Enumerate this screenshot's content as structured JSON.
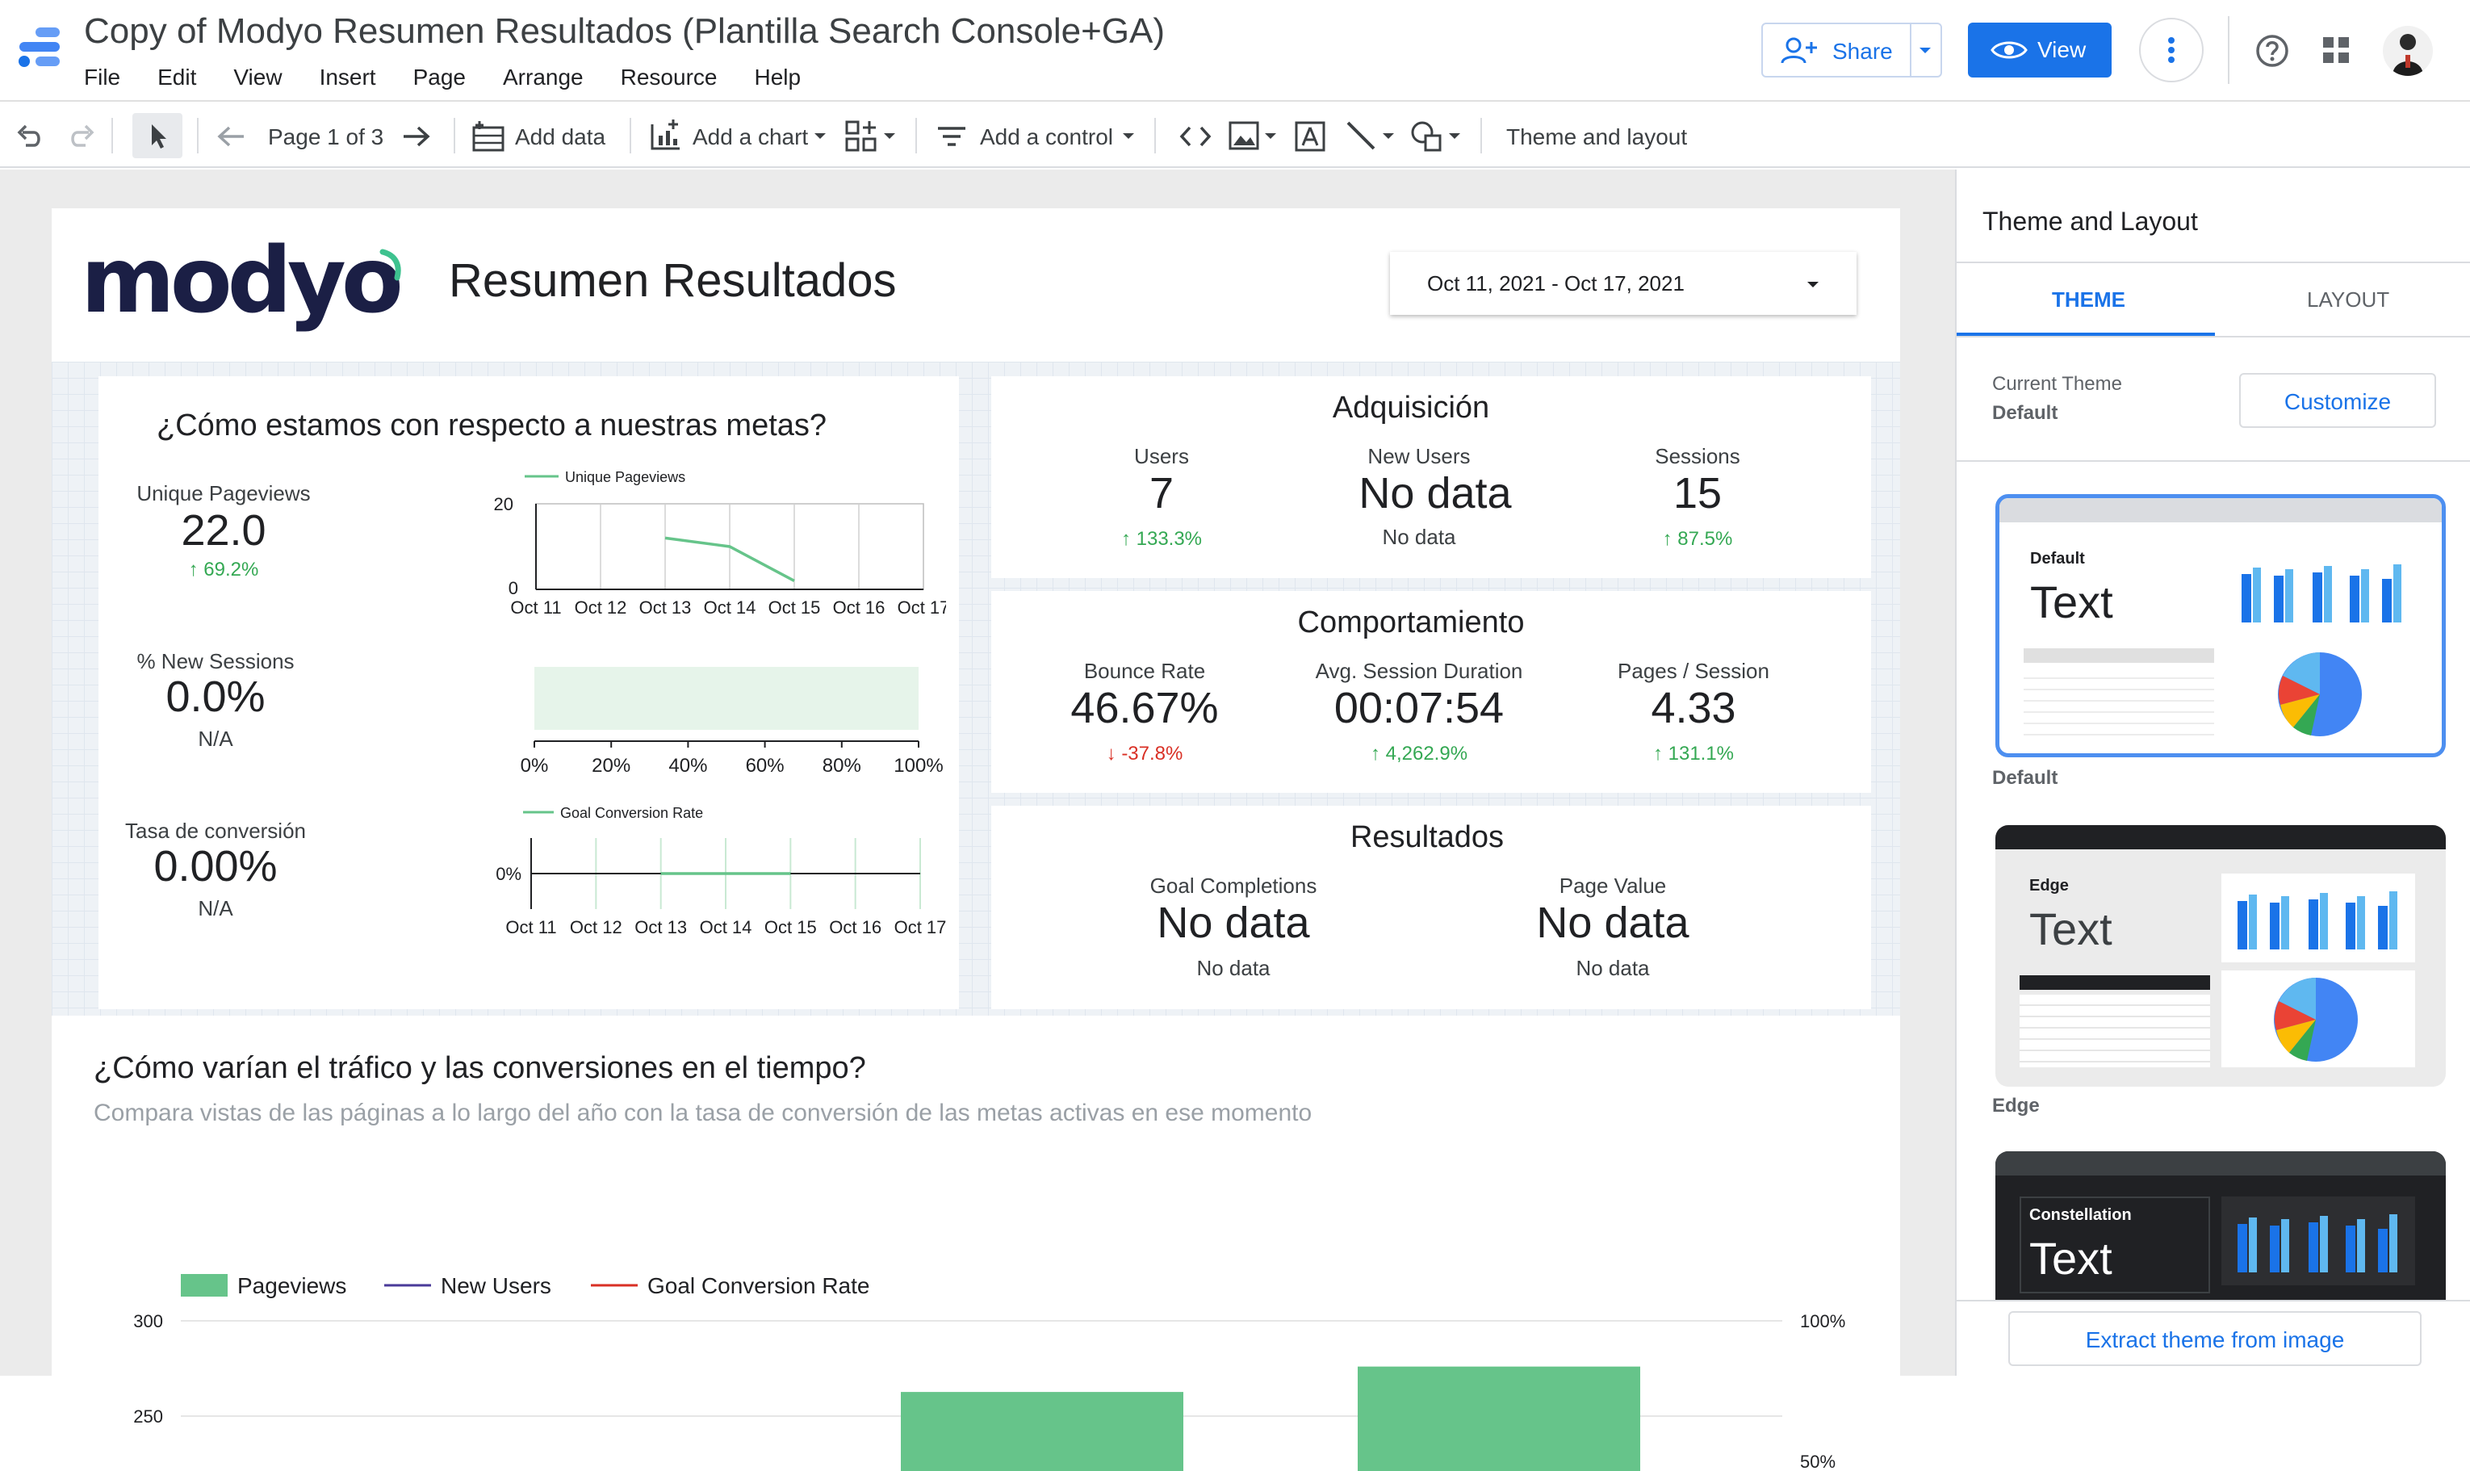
{
  "app": {
    "title": "Copy of Modyo Resumen Resultados (Plantilla Search Console+GA)",
    "menu": [
      "File",
      "Edit",
      "View",
      "Insert",
      "Page",
      "Arrange",
      "Resource",
      "Help"
    ],
    "share_label": "Share",
    "view_label": "View"
  },
  "toolbar": {
    "page_indicator": "Page 1 of 3",
    "add_data": "Add data",
    "add_chart": "Add a chart",
    "add_control": "Add a control",
    "theme_layout": "Theme and layout"
  },
  "report": {
    "logo_text": "modyo",
    "title": "Resumen Resultados",
    "date_range": "Oct 11, 2021 - Oct 17, 2021",
    "goals": {
      "title": "¿Cómo estamos con respecto a nuestras metas?",
      "unique_pageviews": {
        "label": "Unique Pageviews",
        "value": "22.0",
        "delta": "69.2%"
      },
      "new_sessions": {
        "label": "% New Sessions",
        "value": "0.0%",
        "delta": "N/A"
      },
      "conversion": {
        "label": "Tasa de conversión",
        "value": "0.00%",
        "delta": "N/A"
      }
    },
    "acquisition": {
      "title": "Adquisición",
      "metrics": [
        {
          "label": "Users",
          "value": "7",
          "delta": "133.3%"
        },
        {
          "label": "New Users",
          "value": "No data",
          "delta": "No data"
        },
        {
          "label": "Sessions",
          "value": "15",
          "delta": "87.5%"
        }
      ]
    },
    "behavior": {
      "title": "Comportamiento",
      "metrics": [
        {
          "label": "Bounce Rate",
          "value": "46.67%",
          "delta": "-37.8%"
        },
        {
          "label": "Avg. Session Duration",
          "value": "00:07:54",
          "delta": "4,262.9%"
        },
        {
          "label": "Pages / Session",
          "value": "4.33",
          "delta": "131.1%"
        }
      ]
    },
    "results": {
      "title": "Resultados",
      "metrics": [
        {
          "label": "Goal Completions",
          "value": "No data",
          "delta": "No data"
        },
        {
          "label": "Page Value",
          "value": "No data",
          "delta": "No data"
        }
      ]
    },
    "traffic": {
      "title": "¿Cómo varían el tráfico y las conversiones en el tiempo?",
      "subtitle": "Compara vistas de las páginas a lo largo del año con la tasa de conversión de las metas activas en ese momento"
    }
  },
  "chart_data": [
    {
      "type": "line",
      "x": [
        "Oct 11",
        "Oct 12",
        "Oct 13",
        "Oct 14",
        "Oct 15",
        "Oct 16",
        "Oct 17"
      ],
      "series": [
        {
          "name": "Unique Pageviews",
          "values": [
            null,
            null,
            12,
            10,
            2,
            null,
            null
          ]
        }
      ],
      "ylim": [
        0,
        20
      ],
      "yticks": [
        "20",
        "0"
      ],
      "color": "#66c48a"
    },
    {
      "type": "bar",
      "xticks": [
        "0%",
        "20%",
        "40%",
        "60%",
        "80%",
        "100%"
      ],
      "xlim": [
        0,
        100
      ],
      "values": [],
      "color": "#e6f4ea"
    },
    {
      "type": "line",
      "x": [
        "Oct 11",
        "Oct 12",
        "Oct 13",
        "Oct 14",
        "Oct 15",
        "Oct 16",
        "Oct 17"
      ],
      "series": [
        {
          "name": "Goal Conversion Rate",
          "values": [
            null,
            null,
            0,
            0,
            0,
            null,
            null
          ]
        }
      ],
      "yticks": [
        "0%"
      ],
      "color": "#66c48a"
    },
    {
      "type": "bar",
      "legend": [
        {
          "name": "Pageviews",
          "color": "#66c48a"
        },
        {
          "name": "New Users",
          "color": "#4a3a99"
        },
        {
          "name": "Goal Conversion Rate",
          "color": "#d93025"
        }
      ],
      "y_left_ticks": [
        "300",
        "250"
      ],
      "y_right_ticks": [
        "100%",
        "50%"
      ],
      "bars": [
        {
          "value": 244
        },
        {
          "value": 264
        }
      ],
      "ylim_visible": [
        225,
        300
      ]
    }
  ],
  "side_panel": {
    "title": "Theme and Layout",
    "tab_theme": "THEME",
    "tab_layout": "LAYOUT",
    "current_theme_label": "Current Theme",
    "current_theme_value": "Default",
    "customize": "Customize",
    "themes": [
      {
        "card_title": "Default",
        "card_text": "Text",
        "caption": "Default"
      },
      {
        "card_title": "Edge",
        "card_text": "Text",
        "caption": "Edge"
      },
      {
        "card_title": "Constellation",
        "card_text": "Text",
        "caption": ""
      }
    ],
    "extract": "Extract theme from image"
  },
  "colors": {
    "accent": "#1a73e8",
    "positive": "#34a853",
    "negative": "#d93025",
    "chart_green": "#66c48a",
    "logo_navy": "#1b1f45"
  }
}
